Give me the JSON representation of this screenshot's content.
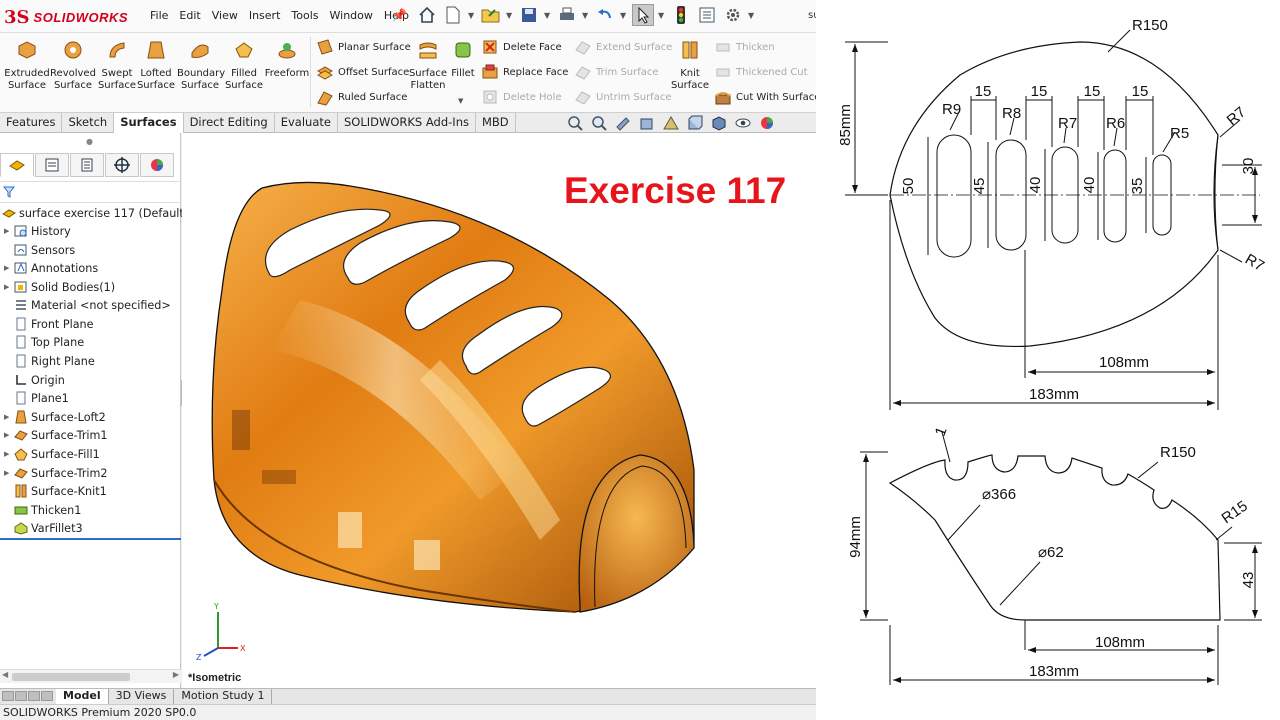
{
  "app": {
    "logo_ds": "3S",
    "logo_text": "SOLIDWORKS",
    "doc_tab_fragment": "su",
    "accent": "#d2001c"
  },
  "menu": [
    "File",
    "Edit",
    "View",
    "Insert",
    "Tools",
    "Window",
    "Help"
  ],
  "ribbon": {
    "extruded": "Extruded Surface",
    "revolved": "Revolved Surface",
    "swept": "Swept Surface",
    "lofted": "Lofted Surface",
    "boundary": "Boundary Surface",
    "filled": "Filled Surface",
    "freeform": "Freeform",
    "planar": "Planar Surface",
    "offset": "Offset Surface",
    "ruled": "Ruled Surface",
    "flatten": "Surface Flatten",
    "fillet": "Fillet",
    "delete_face": "Delete Face",
    "replace_face": "Replace Face",
    "delete_hole": "Delete Hole",
    "extend": "Extend Surface",
    "trim": "Trim Surface",
    "untrim": "Untrim Surface",
    "knit": "Knit Surface",
    "thicken": "Thicken",
    "thickened_cut": "Thickened Cut",
    "cut_with": "Cut With Surface"
  },
  "cm_tabs": [
    "Features",
    "Sketch",
    "Surfaces",
    "Direct Editing",
    "Evaluate",
    "SOLIDWORKS Add-Ins",
    "MBD"
  ],
  "tree": {
    "root": "surface exercise 117  (Default<<",
    "items": [
      "History",
      "Sensors",
      "Annotations",
      "Solid Bodies(1)",
      "Material <not specified>",
      "Front Plane",
      "Top Plane",
      "Right Plane",
      "Origin",
      "Plane1",
      "Surface-Loft2",
      "Surface-Trim1",
      "Surface-Fill1",
      "Surface-Trim2",
      "Surface-Knit1",
      "Thicken1",
      "VarFillet3"
    ]
  },
  "viewport": {
    "view_label": "*Isometric"
  },
  "bottom_tabs": [
    "Model",
    "3D Views",
    "Motion Study 1"
  ],
  "status": "SOLIDWORKS Premium 2020 SP0.0",
  "drawing": {
    "title": "Exercise 117",
    "title_color": "#e8141c",
    "top": {
      "r_arc": "R150",
      "h": "85mm",
      "w_total": "183mm",
      "w_part": "108mm",
      "gaps": [
        "15",
        "15",
        "15",
        "15"
      ],
      "slots": [
        {
          "r": "R9",
          "len": "50"
        },
        {
          "r": "R8",
          "len": "45"
        },
        {
          "r": "R7",
          "len": "40"
        },
        {
          "r": "R6",
          "len": "40"
        },
        {
          "r": "R5",
          "len": "35"
        }
      ],
      "corner_r": "R7",
      "corner_r2": "R7",
      "end_h": "30"
    },
    "side": {
      "thk": "1",
      "r_arc": "R150",
      "d_large": "⌀366",
      "d_small": "⌀62",
      "r_end": "R15",
      "h": "94mm",
      "end_h": "43",
      "w_part": "108mm",
      "w_total": "183mm"
    }
  }
}
